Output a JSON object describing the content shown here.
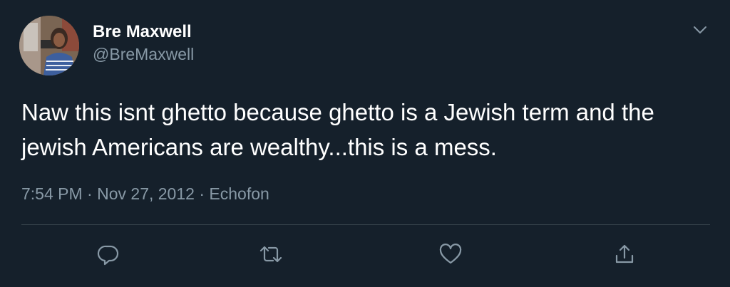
{
  "author": {
    "display_name": "Bre Maxwell",
    "handle": "@BreMaxwell",
    "avatar_icon": "profile-photo"
  },
  "tweet": {
    "text": "Naw this isnt ghetto because ghetto is a Jewish term and the jewish Americans are wealthy...this is a mess.",
    "time": "7:54 PM",
    "date": "Nov 27, 2012",
    "source": "Echofon",
    "separator": " · "
  },
  "actions": [
    {
      "icon": "reply-icon"
    },
    {
      "icon": "retweet-icon"
    },
    {
      "icon": "like-icon"
    },
    {
      "icon": "share-icon"
    }
  ],
  "colors": {
    "background": "#15202b",
    "primary_text": "#ffffff",
    "secondary_text": "#8899a6",
    "divider": "#38444d"
  }
}
